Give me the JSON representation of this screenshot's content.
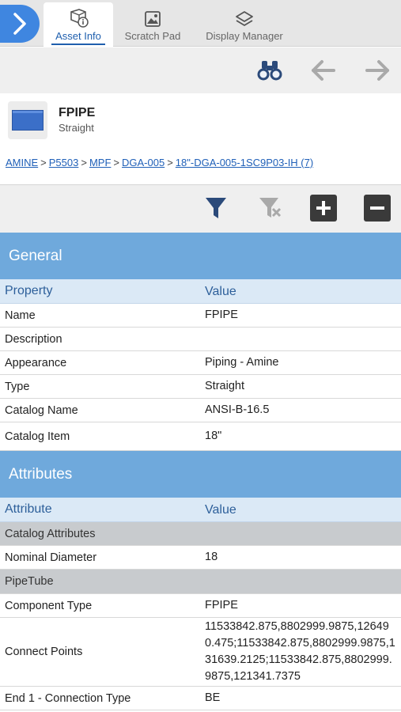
{
  "tabs": [
    {
      "label": "Asset Info",
      "icon": "asset-info-icon",
      "active": true
    },
    {
      "label": "Scratch Pad",
      "icon": "image-icon",
      "active": false
    },
    {
      "label": "Display Manager",
      "icon": "layers-icon",
      "active": false
    }
  ],
  "asset": {
    "name": "FPIPE",
    "type": "Straight"
  },
  "breadcrumb": [
    "AMINE",
    "P5503",
    "MPF",
    "DGA-005",
    "18\"-DGA-005-1SC9P03-IH (7)"
  ],
  "breadcrumb_separator": ">",
  "general": {
    "title": "General",
    "col_property": "Property",
    "col_value": "Value",
    "rows": [
      {
        "name": "Name",
        "value": "FPIPE"
      },
      {
        "name": "Description",
        "value": ""
      },
      {
        "name": "Appearance",
        "value": "Piping - Amine"
      },
      {
        "name": "Type",
        "value": "Straight"
      },
      {
        "name": "Catalog Name",
        "value": "ANSI-B-16.5"
      },
      {
        "name": "Catalog Item",
        "value": "18\""
      }
    ]
  },
  "attributes": {
    "title": "Attributes",
    "col_attribute": "Attribute",
    "col_value": "Value",
    "group_catalog": "Catalog Attributes",
    "nominal_diameter": {
      "name": "Nominal Diameter",
      "value": "18"
    },
    "group_pipetube": "PipeTube",
    "component_type": {
      "name": "Component Type",
      "value": "FPIPE"
    },
    "connect_points": {
      "name": "Connect Points",
      "value": "11533842.875,8802999.9875,126490.475;11533842.875,8802999.9875,131639.2125;11533842.875,8802999.9875,121341.7375"
    },
    "end1": {
      "name": "End 1 - Connection Type",
      "value": "BE"
    }
  },
  "colors": {
    "accent": "#3f86e0",
    "section_header": "#6fa9dc",
    "column_header": "#dbe9f6",
    "group_row": "#c8cbce",
    "link": "#2060b8"
  }
}
